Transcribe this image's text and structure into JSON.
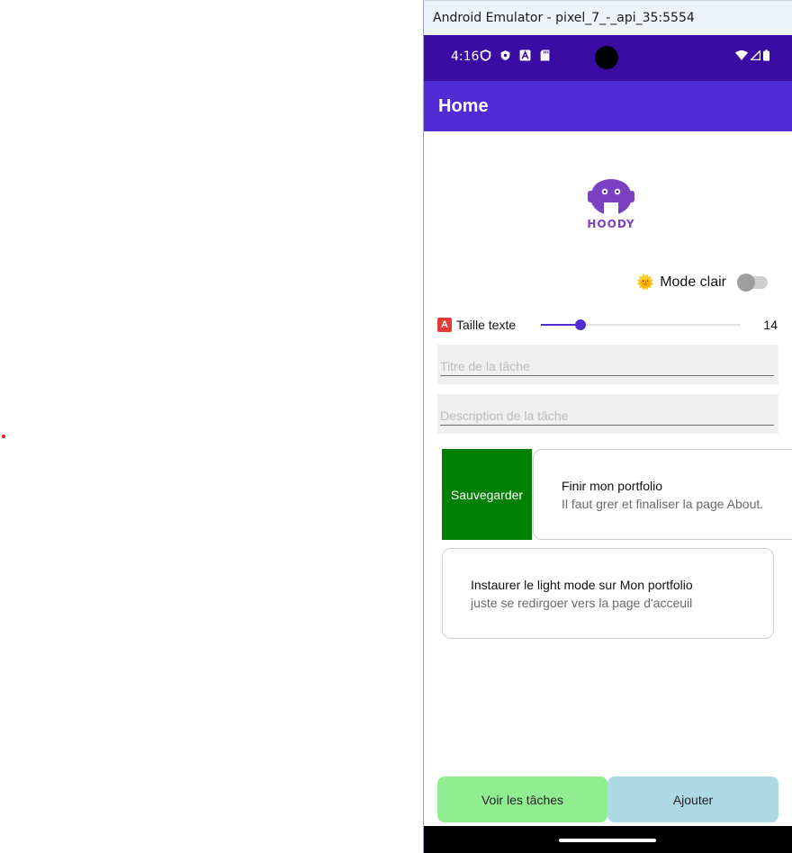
{
  "window": {
    "title": "Android Emulator - pixel_7_-_api_35:5554"
  },
  "status_bar": {
    "time": "4:16"
  },
  "app_bar": {
    "title": "Home"
  },
  "logo": {
    "text": "HOODY"
  },
  "theme_toggle": {
    "emoji": "🌞",
    "label": "Mode clair",
    "on": false
  },
  "text_size": {
    "badge": "A",
    "label": "Taille texte",
    "value": "14",
    "level": 0.2
  },
  "fields": {
    "title_placeholder": "Titre de la tâche",
    "description_placeholder": "Description de la tâche"
  },
  "tasks": [
    {
      "title": "Finir mon portfolio",
      "description": "Il faut grer et finaliser la page About.",
      "swipe_action": "Sauvegarder"
    },
    {
      "title": "Instaurer le light mode sur Mon portfolio",
      "description": "juste se redirgoer vers la page d'acceuil"
    }
  ],
  "buttons": {
    "see_tasks": "Voir les tâches",
    "add": "Ajouter"
  },
  "colors": {
    "status_bar": "#3a0ca3",
    "app_bar": "#512bd4",
    "save_button": "#008000",
    "see_tasks_button": "#90ee90",
    "add_button": "#add8e6"
  }
}
